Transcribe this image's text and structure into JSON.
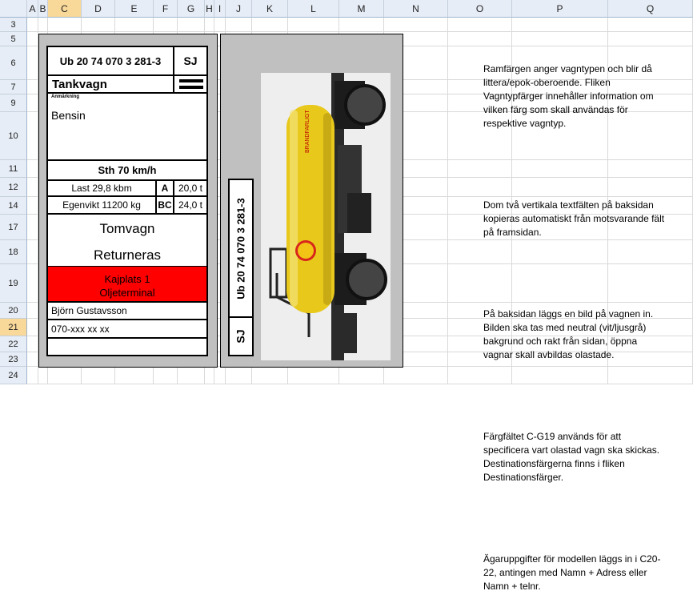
{
  "sheet": {
    "columns": [
      "A",
      "B",
      "C",
      "D",
      "E",
      "F",
      "G",
      "H",
      "I",
      "J",
      "K",
      "L",
      "M",
      "N",
      "O",
      "P",
      "Q"
    ],
    "rows": [
      "3",
      "5",
      "6",
      "7",
      "9",
      "10",
      "11",
      "12",
      "14",
      "17",
      "18",
      "19",
      "20",
      "21",
      "22",
      "23",
      "24"
    ],
    "selected_column": "C",
    "selected_row": "21"
  },
  "card": {
    "wagon_number": "Ub 20 74 070 3 281-3",
    "owner_code": "SJ",
    "wagon_type": "Tankvagn",
    "remark_label": "Anmärkning",
    "remark_value": "Bensin",
    "speed": "Sth 70 km/h",
    "load_label": "Last 29,8 kbm",
    "load_class_a": "A",
    "load_weight_a": "20,0 t",
    "tare_label": "Egenvikt 11200 kg",
    "load_class_bc": "BC",
    "load_weight_bc": "24,0 t",
    "empty_status": "Tomvagn",
    "return_status": "Returneras",
    "destination_line1": "Kajplats 1",
    "destination_line2": "Oljeterminal",
    "owner_name": "Björn Gustavsson",
    "owner_phone": "070-xxx xx xx",
    "tank_brand": "BRANDFARLIGT",
    "destination_color": "#ff0000",
    "tank_color": "#e8c81a"
  },
  "back": {
    "wagon_number": "Ub 20 74 070 3 281-3",
    "owner_code": "SJ"
  },
  "notes": {
    "p1": "Ramfärgen anger vagntypen och blir då littera/epok-oberoende. Fliken Vagntypfärger innehåller information om vilken färg som skall användas för respektive vagntyp.",
    "p2": "Dom två vertikala textfälten på baksidan kopieras automatiskt från motsvarande fält på framsidan.",
    "p3": "På baksidan läggs en bild på vagnen in. Bilden ska tas med neutral (vit/ljusgrå) bakgrund och rakt från sidan, öppna vagnar skall avbildas olastade.",
    "p4": "Färgfältet C-G19 används för att specificera vart olastad vagn ska skickas. Destinationsfärgerna finns i fliken Destinationsfärger.",
    "p5": "Ägaruppgifter för modellen läggs in i C20-22, antingen med Namn + Adress eller Namn + telnr."
  }
}
